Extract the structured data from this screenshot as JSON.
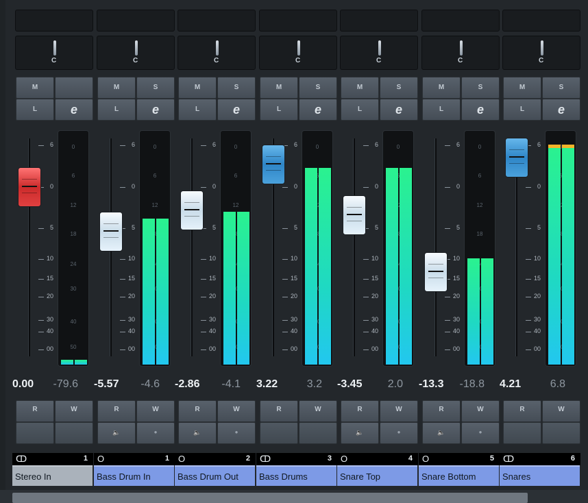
{
  "channels": [
    {
      "name": "Stereo In",
      "number": "1",
      "channel_icon": "stereo-link-icon",
      "circle": "ↀ",
      "pan": "C",
      "fader_value": "0.00",
      "peak_value": "-79.6",
      "fader_color": "red",
      "meter_level": 0.02,
      "peak_clip": false,
      "buttons": {
        "mute": "M",
        "solo": "",
        "listen": "L",
        "edit": "e",
        "read": "R",
        "write": "W"
      },
      "show_monitor_record": false,
      "name_color": "#aab2bb"
    },
    {
      "name": "Bass Drum In",
      "number": "1",
      "channel_icon": "mono-channel-icon",
      "circle": "O",
      "pan": "C",
      "fader_value": "-5.57",
      "peak_value": "-4.6",
      "fader_color": "white",
      "meter_level": 0.63,
      "peak_clip": false,
      "buttons": {
        "mute": "M",
        "solo": "S",
        "listen": "L",
        "edit": "e",
        "read": "R",
        "write": "W"
      },
      "show_monitor_record": true,
      "name_color": "#7d9ae6"
    },
    {
      "name": "Bass Drum Out",
      "number": "2",
      "channel_icon": "mono-channel-icon",
      "circle": "O",
      "pan": "C",
      "fader_value": "-2.86",
      "peak_value": "-4.1",
      "fader_color": "white",
      "meter_level": 0.66,
      "peak_clip": false,
      "buttons": {
        "mute": "M",
        "solo": "S",
        "listen": "L",
        "edit": "e",
        "read": "R",
        "write": "W"
      },
      "show_monitor_record": true,
      "name_color": "#7d9ae6"
    },
    {
      "name": "Bass Drums",
      "number": "3",
      "channel_icon": "stereo-link-icon",
      "circle": "ↀ",
      "pan": "C",
      "fader_value": "3.22",
      "peak_value": "3.2",
      "fader_color": "blue",
      "meter_level": 0.85,
      "peak_clip": false,
      "buttons": {
        "mute": "M",
        "solo": "S",
        "listen": "L",
        "edit": "e",
        "read": "R",
        "write": "W"
      },
      "show_monitor_record": false,
      "name_color": "#7d9ae6"
    },
    {
      "name": "Snare Top",
      "number": "4",
      "channel_icon": "mono-channel-icon",
      "circle": "O",
      "pan": "C",
      "fader_value": "-3.45",
      "peak_value": "2.0",
      "fader_color": "white",
      "meter_level": 0.85,
      "peak_clip": false,
      "buttons": {
        "mute": "M",
        "solo": "S",
        "listen": "L",
        "edit": "e",
        "read": "R",
        "write": "W"
      },
      "show_monitor_record": true,
      "name_color": "#7d9ae6"
    },
    {
      "name": "Snare Bottom",
      "number": "5",
      "channel_icon": "mono-channel-icon",
      "circle": "O",
      "pan": "C",
      "fader_value": "-13.3",
      "peak_value": "-18.8",
      "fader_color": "white",
      "meter_level": 0.46,
      "peak_clip": false,
      "buttons": {
        "mute": "M",
        "solo": "S",
        "listen": "L",
        "edit": "e",
        "read": "R",
        "write": "W"
      },
      "show_monitor_record": true,
      "name_color": "#7d9ae6"
    },
    {
      "name": "Snares",
      "number": "6",
      "channel_icon": "stereo-link-icon",
      "circle": "ↀ",
      "pan": "C",
      "fader_value": "4.21",
      "peak_value": "6.8",
      "fader_color": "blue",
      "meter_level": 0.94,
      "peak_clip": true,
      "buttons": {
        "mute": "M",
        "solo": "S",
        "listen": "L",
        "edit": "e",
        "read": "R",
        "write": "W"
      },
      "show_monitor_record": false,
      "name_color": "#7d9ae6"
    }
  ],
  "fader_scale": [
    "6",
    "0",
    "5",
    "10",
    "15",
    "20",
    "30",
    "40",
    "00"
  ],
  "meter_scale": [
    "0",
    "6",
    "12",
    "18",
    "24",
    "30",
    "40",
    "50"
  ]
}
